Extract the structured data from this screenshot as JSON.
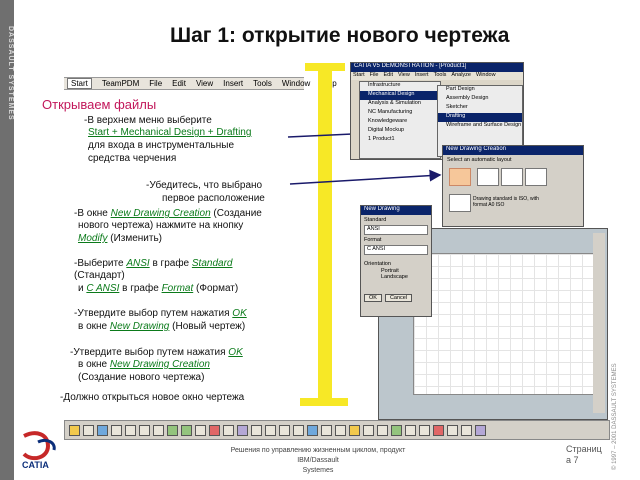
{
  "brand_vertical": "DASSAULT SYSTEMES",
  "title": "Шаг 1: открытие нового чертежа",
  "menubar": {
    "items": [
      "Start",
      "TeamPDM",
      "File",
      "Edit",
      "View",
      "Insert",
      "Tools",
      "Window",
      "Help"
    ]
  },
  "section_title": "Открываем файлы",
  "steps": {
    "s1_prefix": "-В верхнем меню выберите",
    "s1_link": "Start + Mechanical Design + Drafting",
    "s1_line2": "для входа в инструментальные",
    "s1_line3": "средства черчения",
    "s2_line1": "-Убедитесь, что выбрано",
    "s2_line2": "первое расположение",
    "s3_prefix": "-В окне",
    "s3_link": "New Drawing Creation",
    "s3_suffix": "(Создание",
    "s3_line2": "нового чертежа) нажмите на кнопку",
    "s3_link2": "Modify",
    "s3_suffix2": "(Изменить)",
    "s4_prefix": "-Выберите",
    "s4_link": "ANSI",
    "s4_mid": "в графе",
    "s4_link2": "Standard",
    "s4_line2": "(Стандарт)",
    "s4_line3_prefix": "и",
    "s4_link3": "C ANSI",
    "s4_line3_mid": "в графе",
    "s4_link4": "Format",
    "s4_line3_suffix": "(Формат)",
    "s5_prefix": "-Утвердите выбор путем нажатия",
    "s5_link": "OK",
    "s5_line2_prefix": "в окне",
    "s5_link2": "New Drawing",
    "s5_line2_suffix": "(Новый чертеж)",
    "s6_prefix": "-Утвердите выбор путем нажатия",
    "s6_link": "OK",
    "s6_line2_prefix": "в окне",
    "s6_link2": "New Drawing Creation",
    "s6_line3": "(Создание нового чертежа)",
    "s7": "-Должно открыться новое окно чертежа"
  },
  "screens": {
    "win1_title": "CATIA V5 DEMONSTRATION - [Product1]",
    "win1_menu": [
      "Start",
      "File",
      "Edit",
      "View",
      "Insert",
      "Tools",
      "Analyze",
      "Window"
    ],
    "win1_start_items": [
      "Infrastructure",
      "Mechanical Design",
      "Analysis & Simulation",
      "NC Manufacturing",
      "Knowledgeware",
      "Digital Mockup",
      "1 Product1"
    ],
    "win1_sub_items": [
      "Part Design",
      "Assembly Design",
      "Sketcher",
      "Drafting",
      "Wireframe and Surface Design"
    ],
    "win2_title": "New Drawing Creation",
    "win2_label": "Select an automatic layout",
    "win2_info": "Drawing standard is ISO, with format A0 ISO",
    "win3_title": "New Drawing",
    "win3_standard_label": "Standard",
    "win3_standard": "ANSI",
    "win3_format_label": "Format",
    "win3_format": "C ANSI",
    "win3_orientation_label": "Orientation",
    "win3_portrait": "Portrait",
    "win3_landscape": "Landscape",
    "win3_ok": "OK",
    "win3_cancel": "Cancel"
  },
  "footer": {
    "line1": "Решения по управлению жизненным циклом, продукт IBM/Dassault",
    "line2": "Systemes",
    "page_line1": "Страниц",
    "page_line2": "а 7",
    "copyright": "© 1997 – 2001 DASSAULT SYSTEMES",
    "logo_text": "CATIA"
  },
  "colors": {
    "title": "#111111",
    "section": "#c2185b",
    "link": "#0b7a1a",
    "arrow_yellow": "#f7e826",
    "window_title": "#0a246a"
  }
}
